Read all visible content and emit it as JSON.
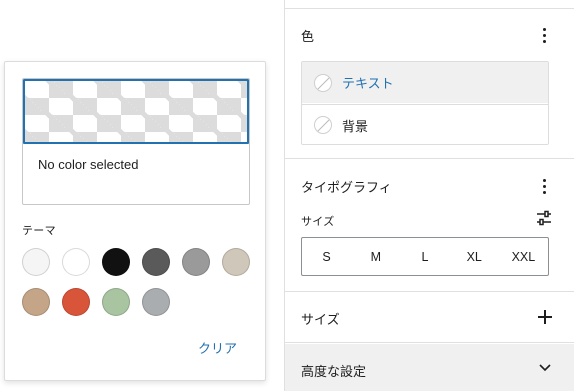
{
  "sidebar": {
    "color_panel": {
      "title": "色",
      "items": [
        {
          "label": "テキスト",
          "icon": "empty-color-swatch-icon"
        },
        {
          "label": "背景",
          "icon": "empty-color-swatch-icon"
        }
      ]
    },
    "typography_panel": {
      "title": "タイポグラフィ",
      "size_label": "サイズ",
      "size_options": [
        "S",
        "M",
        "L",
        "XL",
        "XXL"
      ]
    },
    "dimensions_panel": {
      "title": "サイズ"
    },
    "advanced_panel": {
      "title": "高度な設定"
    }
  },
  "color_popover": {
    "preview_text": "No color selected",
    "theme_label": "テーマ",
    "swatches": [
      {
        "name": "base",
        "color": "#f5f5f5"
      },
      {
        "name": "white",
        "color": "#ffffff"
      },
      {
        "name": "black",
        "color": "#111111"
      },
      {
        "name": "dark-gray",
        "color": "#5a5a5a"
      },
      {
        "name": "gray",
        "color": "#9a9a9a"
      },
      {
        "name": "beige",
        "color": "#cfc7b9"
      },
      {
        "name": "tan",
        "color": "#c4a587"
      },
      {
        "name": "orange-red",
        "color": "#d9553a"
      },
      {
        "name": "sage",
        "color": "#a8c4a0"
      },
      {
        "name": "light-gray",
        "color": "#a9adb0"
      }
    ],
    "clear_label": "クリア"
  },
  "colors": {
    "accent": "#2271b1"
  }
}
